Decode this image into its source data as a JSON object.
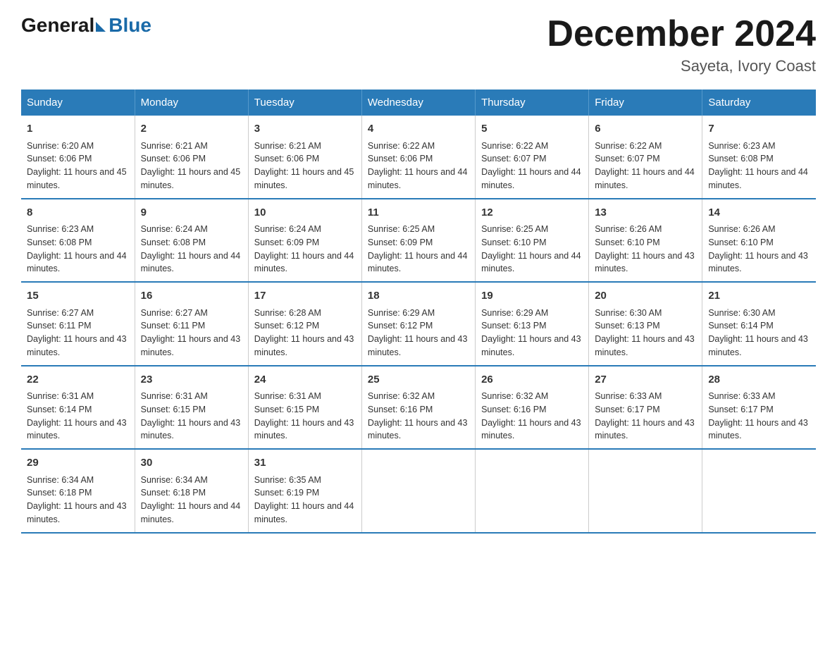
{
  "logo": {
    "general": "General",
    "blue": "Blue"
  },
  "title": "December 2024",
  "subtitle": "Sayeta, Ivory Coast",
  "headers": [
    "Sunday",
    "Monday",
    "Tuesday",
    "Wednesday",
    "Thursday",
    "Friday",
    "Saturday"
  ],
  "weeks": [
    [
      {
        "day": "1",
        "sunrise": "6:20 AM",
        "sunset": "6:06 PM",
        "daylight": "11 hours and 45 minutes."
      },
      {
        "day": "2",
        "sunrise": "6:21 AM",
        "sunset": "6:06 PM",
        "daylight": "11 hours and 45 minutes."
      },
      {
        "day": "3",
        "sunrise": "6:21 AM",
        "sunset": "6:06 PM",
        "daylight": "11 hours and 45 minutes."
      },
      {
        "day": "4",
        "sunrise": "6:22 AM",
        "sunset": "6:06 PM",
        "daylight": "11 hours and 44 minutes."
      },
      {
        "day": "5",
        "sunrise": "6:22 AM",
        "sunset": "6:07 PM",
        "daylight": "11 hours and 44 minutes."
      },
      {
        "day": "6",
        "sunrise": "6:22 AM",
        "sunset": "6:07 PM",
        "daylight": "11 hours and 44 minutes."
      },
      {
        "day": "7",
        "sunrise": "6:23 AM",
        "sunset": "6:08 PM",
        "daylight": "11 hours and 44 minutes."
      }
    ],
    [
      {
        "day": "8",
        "sunrise": "6:23 AM",
        "sunset": "6:08 PM",
        "daylight": "11 hours and 44 minutes."
      },
      {
        "day": "9",
        "sunrise": "6:24 AM",
        "sunset": "6:08 PM",
        "daylight": "11 hours and 44 minutes."
      },
      {
        "day": "10",
        "sunrise": "6:24 AM",
        "sunset": "6:09 PM",
        "daylight": "11 hours and 44 minutes."
      },
      {
        "day": "11",
        "sunrise": "6:25 AM",
        "sunset": "6:09 PM",
        "daylight": "11 hours and 44 minutes."
      },
      {
        "day": "12",
        "sunrise": "6:25 AM",
        "sunset": "6:10 PM",
        "daylight": "11 hours and 44 minutes."
      },
      {
        "day": "13",
        "sunrise": "6:26 AM",
        "sunset": "6:10 PM",
        "daylight": "11 hours and 43 minutes."
      },
      {
        "day": "14",
        "sunrise": "6:26 AM",
        "sunset": "6:10 PM",
        "daylight": "11 hours and 43 minutes."
      }
    ],
    [
      {
        "day": "15",
        "sunrise": "6:27 AM",
        "sunset": "6:11 PM",
        "daylight": "11 hours and 43 minutes."
      },
      {
        "day": "16",
        "sunrise": "6:27 AM",
        "sunset": "6:11 PM",
        "daylight": "11 hours and 43 minutes."
      },
      {
        "day": "17",
        "sunrise": "6:28 AM",
        "sunset": "6:12 PM",
        "daylight": "11 hours and 43 minutes."
      },
      {
        "day": "18",
        "sunrise": "6:29 AM",
        "sunset": "6:12 PM",
        "daylight": "11 hours and 43 minutes."
      },
      {
        "day": "19",
        "sunrise": "6:29 AM",
        "sunset": "6:13 PM",
        "daylight": "11 hours and 43 minutes."
      },
      {
        "day": "20",
        "sunrise": "6:30 AM",
        "sunset": "6:13 PM",
        "daylight": "11 hours and 43 minutes."
      },
      {
        "day": "21",
        "sunrise": "6:30 AM",
        "sunset": "6:14 PM",
        "daylight": "11 hours and 43 minutes."
      }
    ],
    [
      {
        "day": "22",
        "sunrise": "6:31 AM",
        "sunset": "6:14 PM",
        "daylight": "11 hours and 43 minutes."
      },
      {
        "day": "23",
        "sunrise": "6:31 AM",
        "sunset": "6:15 PM",
        "daylight": "11 hours and 43 minutes."
      },
      {
        "day": "24",
        "sunrise": "6:31 AM",
        "sunset": "6:15 PM",
        "daylight": "11 hours and 43 minutes."
      },
      {
        "day": "25",
        "sunrise": "6:32 AM",
        "sunset": "6:16 PM",
        "daylight": "11 hours and 43 minutes."
      },
      {
        "day": "26",
        "sunrise": "6:32 AM",
        "sunset": "6:16 PM",
        "daylight": "11 hours and 43 minutes."
      },
      {
        "day": "27",
        "sunrise": "6:33 AM",
        "sunset": "6:17 PM",
        "daylight": "11 hours and 43 minutes."
      },
      {
        "day": "28",
        "sunrise": "6:33 AM",
        "sunset": "6:17 PM",
        "daylight": "11 hours and 43 minutes."
      }
    ],
    [
      {
        "day": "29",
        "sunrise": "6:34 AM",
        "sunset": "6:18 PM",
        "daylight": "11 hours and 43 minutes."
      },
      {
        "day": "30",
        "sunrise": "6:34 AM",
        "sunset": "6:18 PM",
        "daylight": "11 hours and 44 minutes."
      },
      {
        "day": "31",
        "sunrise": "6:35 AM",
        "sunset": "6:19 PM",
        "daylight": "11 hours and 44 minutes."
      },
      null,
      null,
      null,
      null
    ]
  ]
}
